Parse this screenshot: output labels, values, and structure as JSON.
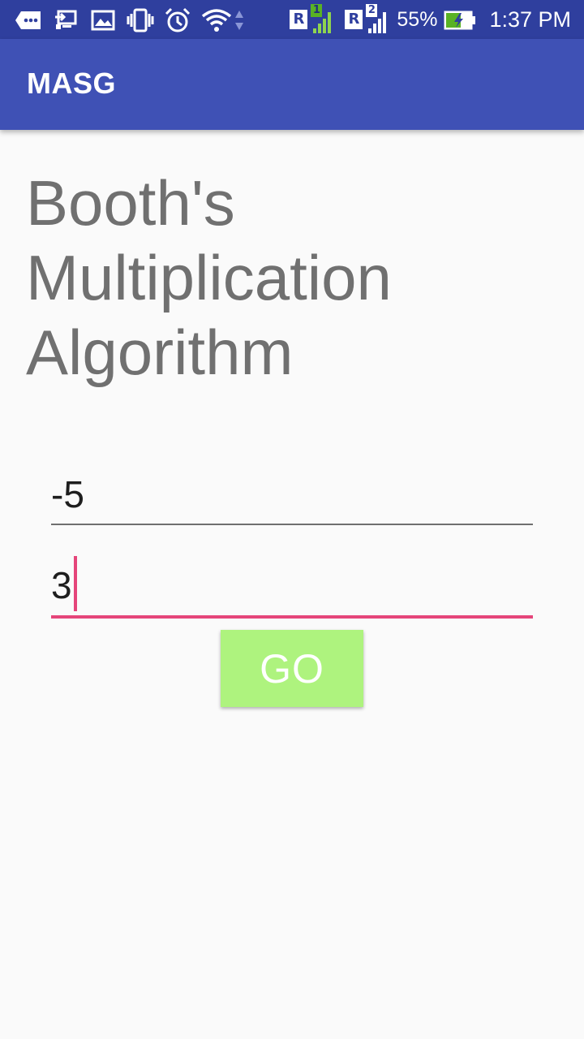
{
  "status_bar": {
    "icons": [
      "more-icon",
      "screen-cast-icon",
      "image-icon",
      "vibrate-icon",
      "alarm-icon",
      "wifi-icon",
      "data-arrows-icon"
    ],
    "sim1": {
      "roaming_label": "R",
      "slot_label": "1"
    },
    "sim2": {
      "roaming_label": "R",
      "slot_label": "2"
    },
    "battery_percent": "55%",
    "battery_charging": true,
    "time": "1:37 PM"
  },
  "app_bar": {
    "title": "MASG",
    "color": "#3f51b5"
  },
  "main": {
    "heading": "Booth's Multiplication Algorithm",
    "first_number": {
      "value": "-5"
    },
    "second_number": {
      "value": "3",
      "focused": true,
      "accent_color": "#e5457a"
    },
    "go_button": {
      "label": "GO",
      "color": "#aef37e"
    }
  }
}
